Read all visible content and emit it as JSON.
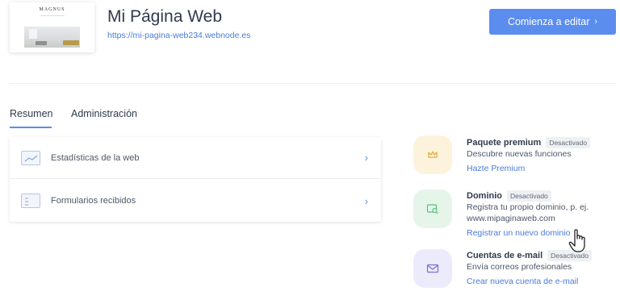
{
  "site": {
    "thumbnail_logo": "MAGNUS",
    "title": "Mi Página Web",
    "url": "https://mi-pagina-web234.webnode.es"
  },
  "edit_button": {
    "label": "Comienza a editar",
    "icon": "chevron-right-icon"
  },
  "tabs": [
    {
      "label": "Resumen",
      "active": true
    },
    {
      "label": "Administración",
      "active": false
    }
  ],
  "list": [
    {
      "label": "Estadísticas de la web",
      "icon": "stats-chart-icon"
    },
    {
      "label": "Formularios recibidos",
      "icon": "form-icon"
    }
  ],
  "features": [
    {
      "title": "Paquete premium",
      "badge": "Desactivado",
      "desc": [
        "Descubre nuevas funciones"
      ],
      "link": "Hazte Premium",
      "icon": "crown-icon",
      "color": "#fdf3dc"
    },
    {
      "title": "Dominio",
      "badge": "Desactivado",
      "desc": [
        "Registra tu propio dominio, p. ej.",
        "www.mipaginaweb.com"
      ],
      "link": "Registrar un nuevo dominio",
      "icon": "domain-search-icon",
      "color": "#e6f5ea"
    },
    {
      "title": "Cuentas de e-mail",
      "badge": "Desactivado",
      "desc": [
        "Envía correos profesionales"
      ],
      "link": "Crear nueva cuenta de e-mail",
      "icon": "mail-icon",
      "color": "#ecebfb"
    }
  ],
  "colors": {
    "accent": "#5b8def",
    "link": "#4a7bd8",
    "text": "#2f3b4d"
  }
}
